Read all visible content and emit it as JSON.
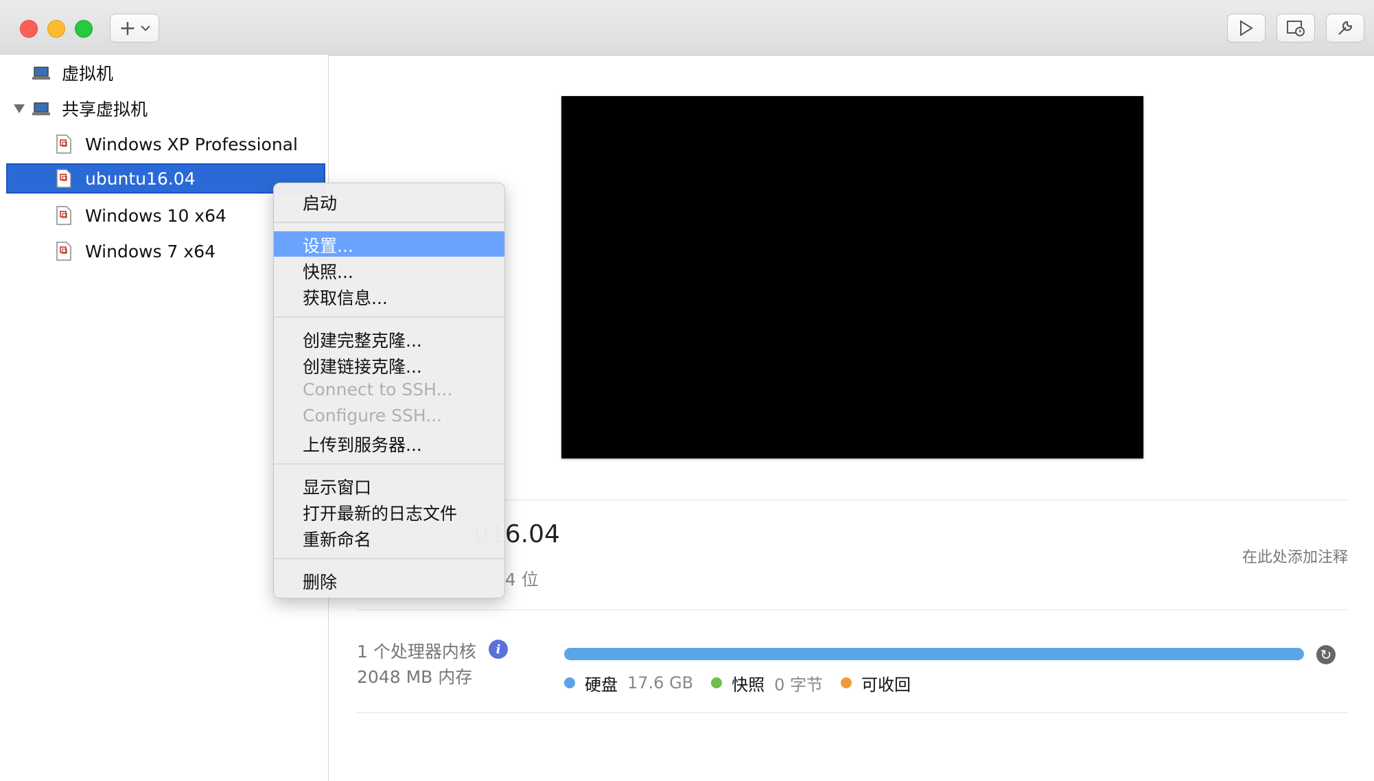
{
  "toolbar": {
    "add_symbol": "+",
    "chevron": "⌄"
  },
  "sidebar": {
    "sections": [
      {
        "label": "虚拟机"
      },
      {
        "label": "共享虚拟机"
      }
    ],
    "items": [
      {
        "label": "Windows XP Professional"
      },
      {
        "label": "ubuntu16.04"
      },
      {
        "label": "Windows 10 x64"
      },
      {
        "label": "Windows 7 x64"
      }
    ]
  },
  "context_menu": {
    "items": [
      {
        "label": "启动"
      },
      {
        "label": "设置..."
      },
      {
        "label": "快照..."
      },
      {
        "label": "获取信息..."
      },
      {
        "label": "创建完整克隆..."
      },
      {
        "label": "创建链接克隆..."
      },
      {
        "label": "Connect to SSH..."
      },
      {
        "label": "Configure SSH..."
      },
      {
        "label": "上传到服务器..."
      },
      {
        "label": "显示窗口"
      },
      {
        "label": "打开最新的日志文件"
      },
      {
        "label": "重新命名"
      },
      {
        "label": "删除"
      }
    ]
  },
  "details": {
    "name_visible": "u16.04",
    "os_visible": "64 位",
    "note_placeholder": "在此处添加注释",
    "cpu": "1 个处理器内核",
    "memory": "2048 MB 内存",
    "info_symbol": "i",
    "refresh_symbol": "↻",
    "storage": {
      "used_fraction": 1.0,
      "legend": [
        {
          "label": "硬盘",
          "value": "17.6 GB",
          "color": "#5aa5e8"
        },
        {
          "label": "快照",
          "value": "0 字节",
          "color": "#6cc04a"
        },
        {
          "label": "可收回",
          "value": "",
          "color": "#f09a3e"
        }
      ]
    }
  }
}
